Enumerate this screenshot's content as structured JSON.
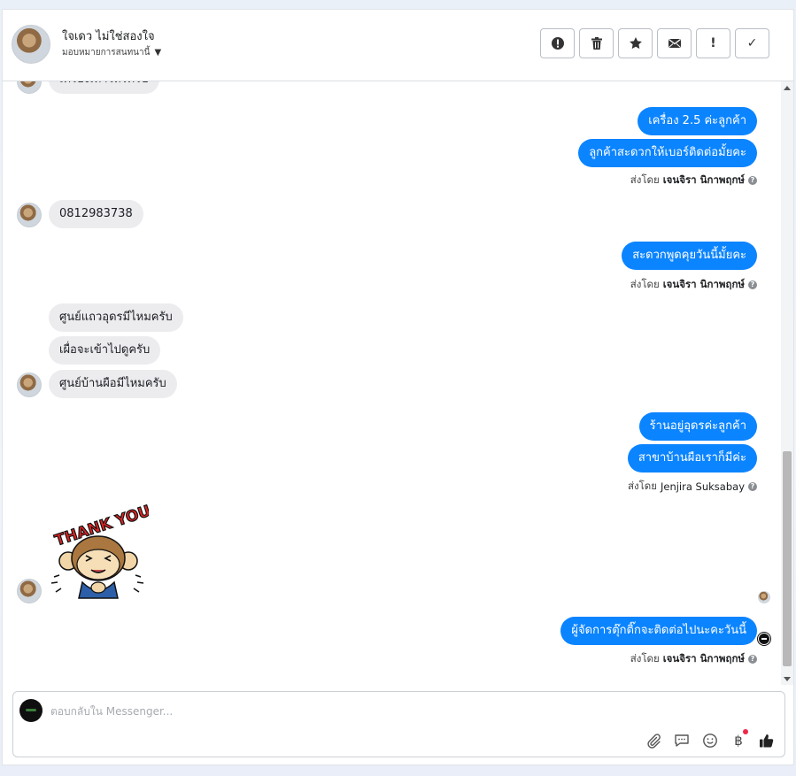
{
  "header": {
    "contact_name": "ใจเดว ไม่ใช่สองใจ",
    "assign_label": "มอบหมายการสนทนานี้",
    "toolbar": [
      {
        "icon": "alert-circle-icon"
      },
      {
        "icon": "trash-icon"
      },
      {
        "icon": "star-icon"
      },
      {
        "icon": "envelope-icon"
      },
      {
        "icon": "exclamation-icon"
      },
      {
        "icon": "check-icon"
      }
    ]
  },
  "messages": {
    "partial_top": "เครื่องเท่าไหร่ครับ",
    "out_1": "เครื่อง 2.5 ค่ะลูกค้า",
    "out_2": "ลูกค้าสะดวกให้เบอร์ติดต่อมั้ยคะ",
    "phone": "0812983738",
    "out_3": "สะดวกพูดคุยวันนี้มั้ยคะ",
    "in_1": "ศูนย์แถวอุดรมีไหมครับ",
    "in_2": "เผื่อจะเข้าไปดูครับ",
    "in_3": "ศูนย์บ้านผือมีไหมครับ",
    "out_4": "ร้านอยู่อุดรค่ะลูกค้า",
    "out_5": "สาขาบ้านผือเราก็มีค่ะ",
    "out_6": "ผู้จัดการตุ๊กติ๊กจะติดต่อไปนะคะวันนี้"
  },
  "sent_by": {
    "prefix": "ส่งโดย",
    "agent_1": "เจนจิรา นิกาพฤกษ์",
    "agent_2": "เจนจิรา นิกาพฤกษ์",
    "agent_3": "Jenjira Suksabay",
    "agent_4": "เจนจิรา นิกาพฤกษ์"
  },
  "sticker": {
    "text": "THANK YOU"
  },
  "composer": {
    "placeholder": "ตอบกลับใน Messenger...",
    "value": "",
    "tools": [
      "paperclip-icon",
      "chat-bubble-icon",
      "emoji-icon",
      "baht-icon",
      "thumbs-up-icon"
    ],
    "baht_symbol": "฿"
  },
  "colors": {
    "outgoing_bubble": "#0b84ff",
    "incoming_bubble": "#ececef",
    "notification_dot": "#f02849"
  }
}
